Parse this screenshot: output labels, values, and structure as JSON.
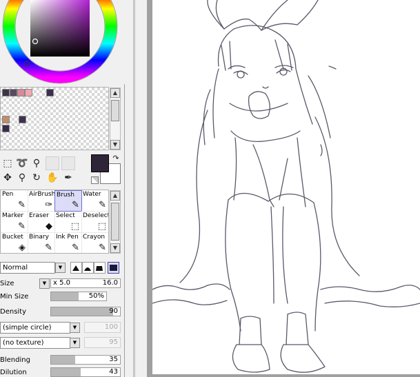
{
  "colors": {
    "foreground": "#2e2538",
    "background": "#ffffff",
    "wheel_hue": "#b020d0",
    "swatches": [
      "#3c3448",
      "#5a4860",
      "#d68a98",
      "#f0a8b0",
      "#3c3050",
      "#c08c6c",
      "#403050",
      "#382c48"
    ]
  },
  "selection_tools": [
    {
      "icon": "rect-select-icon"
    },
    {
      "icon": "lasso-icon"
    },
    {
      "icon": "magic-wand-icon"
    },
    {
      "icon": "move-icon"
    },
    {
      "icon": "zoom-icon"
    },
    {
      "icon": "rotate-icon"
    },
    {
      "icon": "hand-icon"
    },
    {
      "icon": "eyedropper-icon"
    }
  ],
  "brush_tools": [
    {
      "label": "Pen",
      "icon": "pen-icon",
      "glyph": "✎"
    },
    {
      "label": "AirBrush",
      "icon": "airbrush-icon",
      "glyph": "✑"
    },
    {
      "label": "Brush",
      "icon": "brush-icon",
      "glyph": "✎"
    },
    {
      "label": "Water",
      "icon": "water-brush-icon",
      "glyph": "✎"
    },
    {
      "label": "Marker",
      "icon": "marker-icon",
      "glyph": "✎"
    },
    {
      "label": "Eraser",
      "icon": "eraser-icon",
      "glyph": "◆"
    },
    {
      "label": "Select",
      "icon": "select-brush-icon",
      "glyph": "⬚"
    },
    {
      "label": "Deselect",
      "icon": "deselect-icon",
      "glyph": "⬚"
    },
    {
      "label": "Bucket",
      "icon": "bucket-icon",
      "glyph": "◈"
    },
    {
      "label": "Binary",
      "icon": "binary-pen-icon",
      "glyph": "✎"
    },
    {
      "label": "Ink Pen",
      "icon": "ink-pen-icon",
      "glyph": "✎"
    },
    {
      "label": "Crayon",
      "icon": "crayon-icon",
      "glyph": "✎"
    }
  ],
  "blend_mode": "Normal",
  "size": {
    "label": "Size",
    "multiplier": "x 5.0",
    "value": "16.0"
  },
  "min_size": {
    "label": "Min Size",
    "value": "50%",
    "fraction": 0.5
  },
  "density": {
    "label": "Density",
    "value": "90",
    "fraction": 0.9
  },
  "shape_combo": {
    "value": "(simple circle)",
    "disabled_value": "100"
  },
  "texture_combo": {
    "value": "(no texture)",
    "disabled_value": "95"
  },
  "blending": {
    "label": "Blending",
    "value": "35",
    "fraction": 0.35
  },
  "dilution": {
    "label": "Dilution",
    "value": "43",
    "fraction": 0.43
  }
}
